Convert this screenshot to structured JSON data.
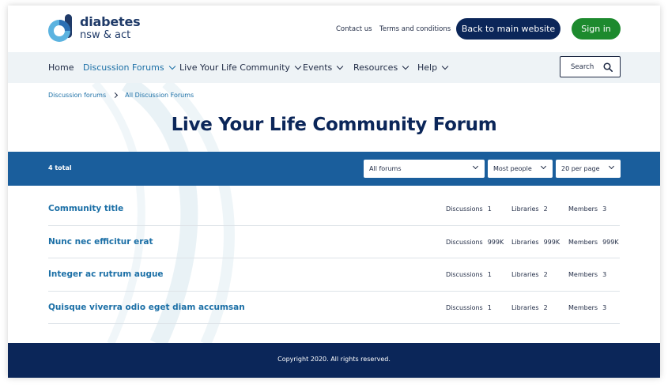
{
  "brand": {
    "line1": "diabetes",
    "line2": "nsw & act",
    "primary_color": "#0b2659",
    "accent_color": "#1b6fa6",
    "success_color": "#1d8a2e"
  },
  "header": {
    "contact_label": "Contact us",
    "terms_label": "Terms and conditions",
    "back_label": "Back to main website",
    "signin_label": "Sign in"
  },
  "nav": {
    "items": [
      {
        "label": "Home",
        "dropdown": false,
        "active": false
      },
      {
        "label": "Discussion Forums",
        "dropdown": true,
        "active": true
      },
      {
        "label": "Live Your Life Community",
        "dropdown": true,
        "active": false
      },
      {
        "label": "Events",
        "dropdown": true,
        "active": false
      },
      {
        "label": "Resources",
        "dropdown": true,
        "active": false
      },
      {
        "label": "Help",
        "dropdown": true,
        "active": false
      }
    ],
    "search_label": "Search",
    "search_icon": "search-icon"
  },
  "breadcrumb": {
    "items": [
      "Discussion forums",
      "All Discussion Forums"
    ]
  },
  "page": {
    "title": "Live Your Life Community Forum"
  },
  "filters": {
    "total_label": "4 total",
    "forum_select": "All forums",
    "sort_select": "Most people",
    "per_page_select": "20 per page"
  },
  "list": {
    "stat_labels": {
      "discussions": "Discussions",
      "libraries": "Libraries",
      "members": "Members"
    },
    "rows": [
      {
        "title": "Community title",
        "discussions": "1",
        "libraries": "2",
        "members": "3"
      },
      {
        "title": "Nunc nec efficitur erat",
        "discussions": "999K",
        "libraries": "999K",
        "members": "999K"
      },
      {
        "title": "Integer ac rutrum augue",
        "discussions": "1",
        "libraries": "2",
        "members": "3"
      },
      {
        "title": "Quisque viverra odio eget diam accumsan",
        "discussions": "1",
        "libraries": "2",
        "members": "3"
      }
    ]
  },
  "footer": {
    "copyright": "Copyright 2020. All rights reserved."
  }
}
